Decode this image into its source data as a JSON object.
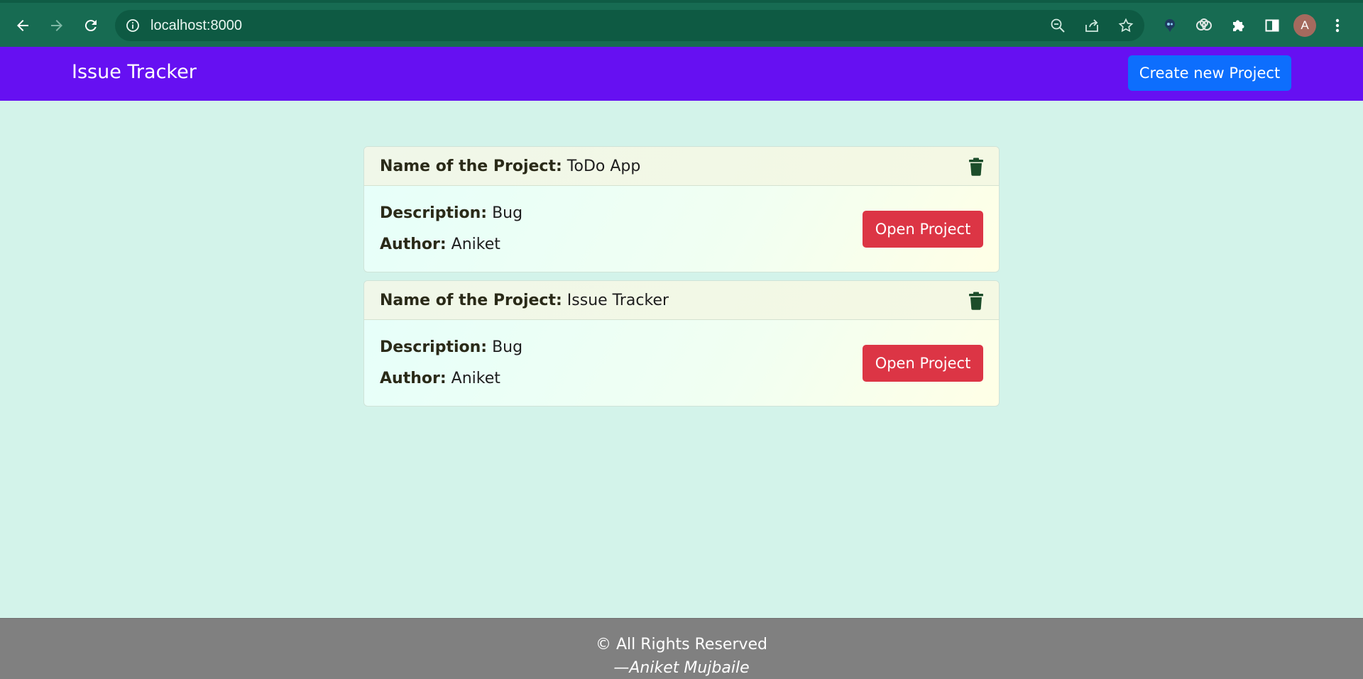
{
  "browser": {
    "url": "localhost:8000",
    "profile_initial": "A",
    "icons": [
      "back-arrow-icon",
      "forward-arrow-icon",
      "reload-icon",
      "info-icon",
      "zoom-out-icon",
      "share-icon",
      "star-icon",
      "extension-icon",
      "puzzle-icon",
      "side-panel-icon",
      "more-vert-icon"
    ]
  },
  "navbar": {
    "brand": "Issue Tracker",
    "create_label": "Create new Project",
    "colors": {
      "bar": "#6610f2",
      "button": "#0d6efd"
    }
  },
  "projects": [
    {
      "name_label": "Name of the Project:",
      "name": "ToDo App",
      "description_label": "Description:",
      "description": "Bug",
      "author_label": "Author:",
      "author": "Aniket",
      "open_label": "Open Project"
    },
    {
      "name_label": "Name of the Project:",
      "name": "Issue Tracker",
      "description_label": "Description:",
      "description": "Bug",
      "author_label": "Author:",
      "author": "Aniket",
      "open_label": "Open Project"
    }
  ],
  "footer": {
    "copyright": "© All Rights Reserved",
    "signature": "—Aniket Mujbaile"
  },
  "colors": {
    "page_bg": "#d3f3ea",
    "open_button": "#dc3545",
    "trash_icon": "#1c4d2a",
    "footer_bg": "#808080"
  }
}
